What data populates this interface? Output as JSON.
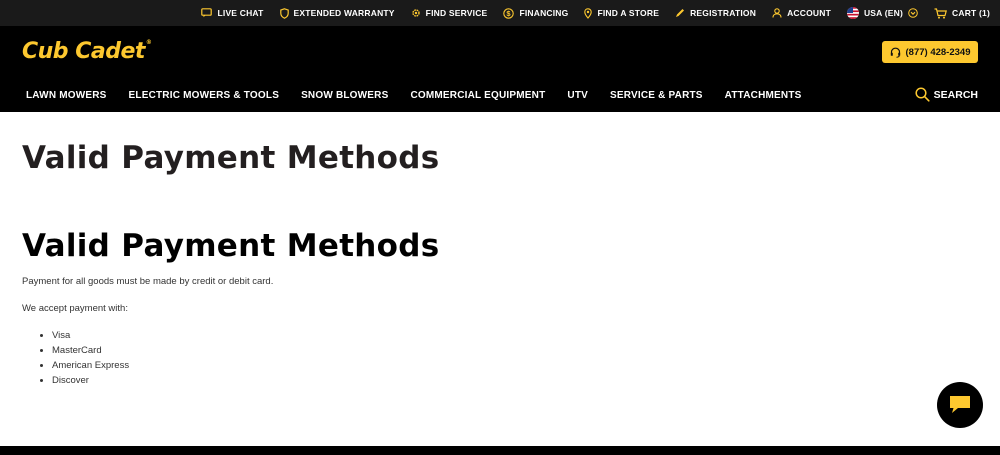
{
  "utility": {
    "live_chat": "LIVE CHAT",
    "extended_warranty": "EXTENDED WARRANTY",
    "find_service": "FIND SERVICE",
    "financing": "FINANCING",
    "find_store": "FIND A STORE",
    "registration": "REGISTRATION",
    "account": "ACCOUNT",
    "country": "USA (EN)",
    "cart": "CART (1)"
  },
  "brand": {
    "logo": "Cub Cadet",
    "phone": "(877) 428-2349",
    "accent": "#fdc82f"
  },
  "nav": {
    "items": [
      "LAWN MOWERS",
      "ELECTRIC MOWERS & TOOLS",
      "SNOW BLOWERS",
      "COMMERCIAL EQUIPMENT",
      "UTV",
      "SERVICE & PARTS",
      "ATTACHMENTS"
    ],
    "search": "SEARCH"
  },
  "content": {
    "page_title": "Valid Payment Methods",
    "section_title": "Valid Payment Methods",
    "intro": "Payment for all goods must be made by credit or debit card.",
    "accept_label": "We accept payment with:",
    "methods": [
      "Visa",
      "MasterCard",
      "American Express",
      "Discover"
    ]
  }
}
